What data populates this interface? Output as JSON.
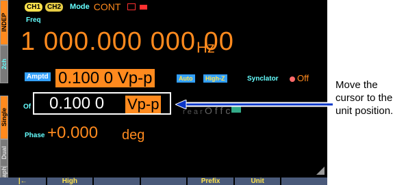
{
  "side_tabs": {
    "indep": "INDEP",
    "two_ch": "2ch",
    "single": "Single",
    "dual": "Dual",
    "graph": "Graph"
  },
  "header": {
    "ch1": "CH1",
    "ch2": "CH2",
    "mode_label": "Mode",
    "mode_value": "CONT"
  },
  "frequency": {
    "label": "Freq",
    "value": "1 000.000 000 00",
    "unit": "Hz"
  },
  "amplitude": {
    "label": "Amptd",
    "value": "0.100 0 Vp-p",
    "auto": "Auto",
    "high_z": "High-Z"
  },
  "synclator": {
    "label": "Synclator",
    "state": "Off"
  },
  "offset_edit": {
    "label": "Of",
    "value": "0.100 0",
    "unit": "Vp-p",
    "ghost1": "r e a r",
    "ghost2": "O f f c"
  },
  "phase": {
    "label": "Phase",
    "value": "+0.000",
    "unit": "deg"
  },
  "softkeys": [
    "|←",
    "High",
    "",
    "",
    "Prefix",
    "Unit",
    ""
  ],
  "annotation": {
    "line1": "Move the",
    "line2": "cursor to the",
    "line3": "unit position."
  },
  "colors": {
    "accent": "#ff8a1e",
    "label": "#66ffff",
    "key": "#33a0ff",
    "arrow": "#0a36c8"
  }
}
